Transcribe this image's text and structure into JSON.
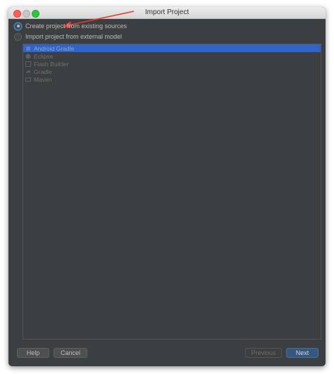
{
  "window": {
    "title": "Import Project"
  },
  "options": [
    {
      "label": "Create project from existing sources",
      "checked": true
    },
    {
      "label": "Import project from external model",
      "checked": false
    }
  ],
  "models": [
    {
      "label": "Android Gradle",
      "icon": "android-icon",
      "selected": true
    },
    {
      "label": "Eclipse",
      "icon": "eclipse-icon",
      "selected": false
    },
    {
      "label": "Flash Builder",
      "icon": "flash-builder-icon",
      "selected": false
    },
    {
      "label": "Gradle",
      "icon": "gradle-icon",
      "selected": false
    },
    {
      "label": "Maven",
      "icon": "maven-icon",
      "selected": false
    }
  ],
  "footer": {
    "help_label": "Help",
    "cancel_label": "Cancel",
    "previous_label": "Previous",
    "next_label": "Next"
  },
  "colors": {
    "background": "#3c3f41",
    "selection": "#2f65ca",
    "primary_button": "#365880",
    "annotation_arrow": "#e53935"
  }
}
